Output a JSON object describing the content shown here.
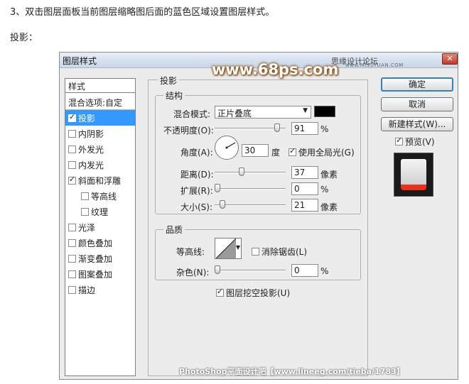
{
  "intro_text": "3、双击图层面板当前图层缩略图后面的蓝色区域设置图层样式。",
  "caption": "投影：",
  "dialog": {
    "title": "图层样式",
    "watermark_top": "思缘设计论坛",
    "watermark_url": "www.MISSYUAN.COM",
    "logo": "www.68ps.com",
    "watermark_bottom": "PhotoShop平面设计吧【www.lineeg.com/tieba/1783】"
  },
  "style_list": {
    "header": "样式",
    "items": [
      {
        "label": "混合选项:自定",
        "checkbox": null,
        "selected": false
      },
      {
        "label": "投影",
        "checkbox": true,
        "selected": true
      },
      {
        "label": "内阴影",
        "checkbox": false,
        "selected": false
      },
      {
        "label": "外发光",
        "checkbox": false,
        "selected": false
      },
      {
        "label": "内发光",
        "checkbox": false,
        "selected": false
      },
      {
        "label": "斜面和浮雕",
        "checkbox": true,
        "selected": false
      },
      {
        "label": "等高线",
        "checkbox": false,
        "selected": false
      },
      {
        "label": "纹理",
        "checkbox": false,
        "selected": false
      },
      {
        "label": "光泽",
        "checkbox": false,
        "selected": false
      },
      {
        "label": "颜色叠加",
        "checkbox": false,
        "selected": false
      },
      {
        "label": "渐变叠加",
        "checkbox": false,
        "selected": false
      },
      {
        "label": "图案叠加",
        "checkbox": false,
        "selected": false
      },
      {
        "label": "描边",
        "checkbox": false,
        "selected": false
      }
    ]
  },
  "drop_shadow": {
    "section_title": "投影",
    "structure": {
      "title": "结构",
      "blend_mode_label": "混合模式:",
      "blend_mode_value": "正片叠底",
      "shadow_color": "#000000",
      "opacity_label": "不透明度(O):",
      "opacity_value": "91",
      "opacity_unit": "%",
      "opacity_level": 0.91,
      "angle_label": "角度(A):",
      "angle_value": "30",
      "angle_unit": "度",
      "global_light_label": "使用全局光(G)",
      "global_light_checked": true,
      "distance_label": "距离(D):",
      "distance_value": "37",
      "distance_unit": "像素",
      "distance_level": 0.37,
      "spread_label": "扩展(R):",
      "spread_value": "0",
      "spread_unit": "%",
      "spread_level": 0,
      "size_label": "大小(S):",
      "size_value": "21",
      "size_unit": "像素",
      "size_level": 0.08
    },
    "quality": {
      "title": "品质",
      "contour_label": "等高线:",
      "anti_alias_label": "消除锯齿(L)",
      "anti_alias_checked": false,
      "noise_label": "杂色(N):",
      "noise_value": "0",
      "noise_unit": "%",
      "noise_level": 0
    },
    "knockout_label": "图层挖空投影(U)",
    "knockout_checked": true
  },
  "buttons": {
    "ok": "确定",
    "cancel": "取消",
    "new_style": "新建样式(W)...",
    "preview_label": "预览(V)",
    "preview_checked": true
  },
  "colors": {
    "selection": "#3399ff",
    "preview_red": "#e8321e"
  }
}
